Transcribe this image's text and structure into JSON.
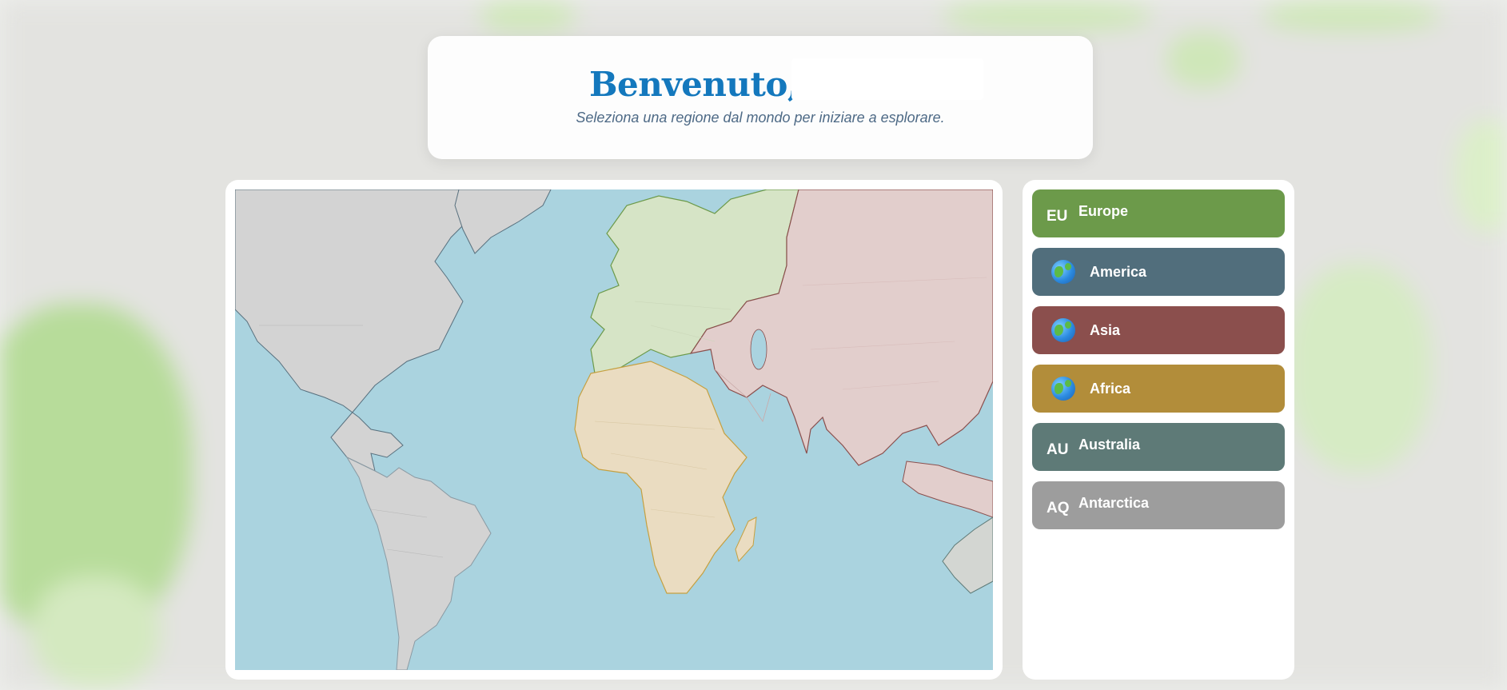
{
  "header": {
    "welcome": "Benvenuto,",
    "subtitle": "Seleziona una regione dal mondo per iniziare a esplorare."
  },
  "regions": [
    {
      "code": "EU",
      "icon": "",
      "label": "Europe",
      "color": "#6c9a4a"
    },
    {
      "code": "",
      "icon": "globe-icon",
      "label": "America",
      "color": "#516e7c"
    },
    {
      "code": "",
      "icon": "globe-icon",
      "label": "Asia",
      "color": "#8b4f4d"
    },
    {
      "code": "",
      "icon": "globe-icon",
      "label": "Africa",
      "color": "#b28d3a"
    },
    {
      "code": "AU",
      "icon": "",
      "label": "Australia",
      "color": "#5e7a77"
    },
    {
      "code": "AQ",
      "icon": "",
      "label": "Antarctica",
      "color": "#9d9d9d"
    }
  ],
  "map": {
    "ocean_color": "#aad3df",
    "region_colors": {
      "europe": "#d6e4c6",
      "america": "#d3d3d3",
      "asia": "#e2cecc",
      "africa": "#eadcc1",
      "australia": "#d3d6d2"
    }
  }
}
